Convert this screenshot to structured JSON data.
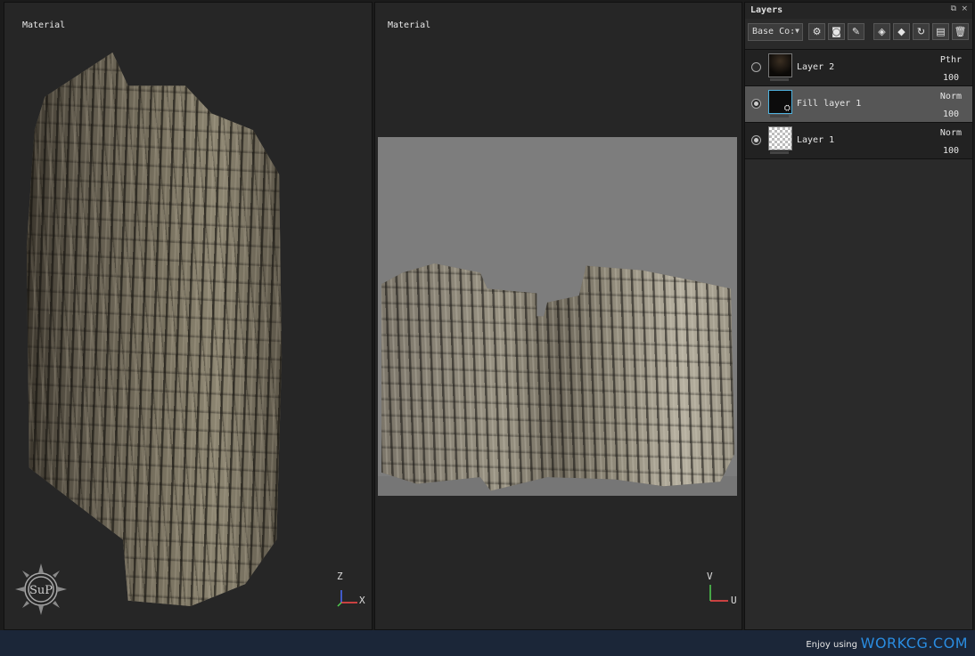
{
  "viewport_3d": {
    "title": "Material",
    "gizmo": {
      "up_axis": "Z",
      "right_axis": "X"
    },
    "compass_logo_text": "SuP"
  },
  "viewport_2d": {
    "title": "Material",
    "gizmo": {
      "up_axis": "V",
      "right_axis": "U"
    }
  },
  "layers_panel": {
    "title": "Layers",
    "float_icon": "⧉",
    "close_icon": "×",
    "blend_mode_select": "Base Co:",
    "toolbar_icons": [
      "channels-icon",
      "mask-icon",
      "paint-icon",
      "add-layer-icon",
      "add-fill-icon",
      "add-effect-icon",
      "add-folder-icon",
      "delete-icon"
    ],
    "layers": [
      {
        "name": "Layer 2",
        "blend": "Pthr",
        "opacity": "100",
        "visible": false,
        "selected": false,
        "thumb": "dark"
      },
      {
        "name": "Fill layer 1",
        "blend": "Norm",
        "opacity": "100",
        "visible": true,
        "selected": true,
        "thumb": "sel"
      },
      {
        "name": "Layer 1",
        "blend": "Norm",
        "opacity": "100",
        "visible": true,
        "selected": false,
        "thumb": "checker"
      }
    ]
  },
  "statusbar": {
    "text": "Enjoy using",
    "brand": "WORKCG.COM"
  },
  "colors": {
    "accent_blue": "#2a8ce0",
    "statusbar_bg": "#1b2638",
    "viewport_bg": "#262626"
  }
}
